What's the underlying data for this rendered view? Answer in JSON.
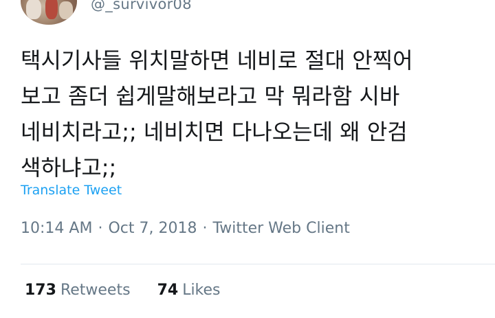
{
  "user": {
    "handle": "@_survivor08"
  },
  "tweet": {
    "lines": [
      "택시기사들 위치말하면 네비로 절대 안찍어",
      "보고 좀더 쉽게말해보라고 막 뭐라함 시바",
      "네비치라고;; 네비치면 다나오는데 왜 안검",
      "색하냐고;;"
    ],
    "translate_label": "Translate Tweet"
  },
  "meta": {
    "time": "10:14 AM",
    "date": "Oct 7, 2018",
    "client": "Twitter Web Client",
    "separator": "·"
  },
  "stats": {
    "retweets_count": "173",
    "retweets_label": "Retweets",
    "likes_count": "74",
    "likes_label": "Likes"
  },
  "colors": {
    "text": "#14171a",
    "secondary": "#657786",
    "link": "#1da1f2",
    "divider": "#e1e8ed"
  }
}
